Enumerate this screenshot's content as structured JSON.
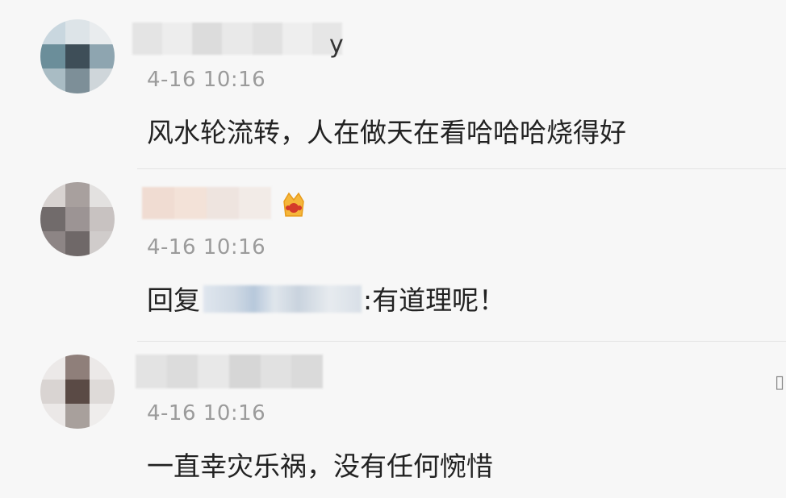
{
  "comments": [
    {
      "name_visible": "y",
      "time": "4-16 10:16",
      "text": "风水轮流转，人在做天在看哈哈哈烧得好"
    },
    {
      "name_visible": "",
      "time": "4-16 10:16",
      "reply_prefix": "回复",
      "reply_suffix": ":有道理呢！",
      "badge_icon": "crown-badge-icon"
    },
    {
      "name_visible": "",
      "time": "4-16 10:16",
      "text": "一直幸灾乐祸，没有任何惋惜"
    }
  ],
  "edge_mark": "▯"
}
